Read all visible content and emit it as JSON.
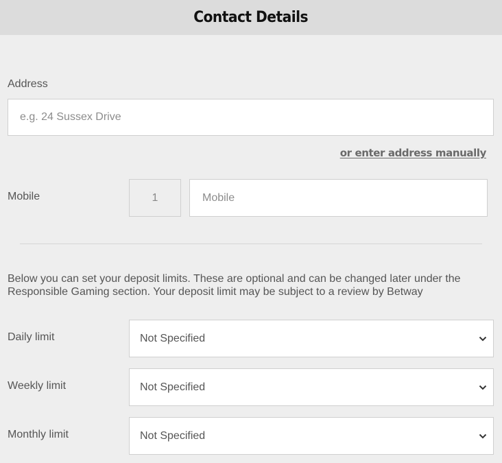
{
  "header": {
    "title": "Contact Details"
  },
  "address": {
    "label": "Address",
    "placeholder": "e.g. 24 Sussex Drive",
    "value": "",
    "manual_link": "or enter address manually"
  },
  "mobile": {
    "label": "Mobile",
    "country_code": "1",
    "placeholder": "Mobile",
    "value": ""
  },
  "deposit_info": "Below you can set your deposit limits. These are optional and can be changed later under the Responsible Gaming section. Your deposit limit may be subject to a review by Betway",
  "limits": [
    {
      "label": "Daily limit",
      "selected": "Not Specified",
      "icon": "chevron-down-icon"
    },
    {
      "label": "Weekly limit",
      "selected": "Not Specified",
      "icon": "chevron-down-icon"
    },
    {
      "label": "Monthly limit",
      "selected": "Not Specified",
      "icon": "chevron-down-icon"
    }
  ],
  "colors": {
    "header_bg": "#dcdcdc",
    "page_bg": "#eeeeee",
    "border": "#cfcfcf",
    "text": "#555555",
    "link": "#6a6a6a"
  }
}
